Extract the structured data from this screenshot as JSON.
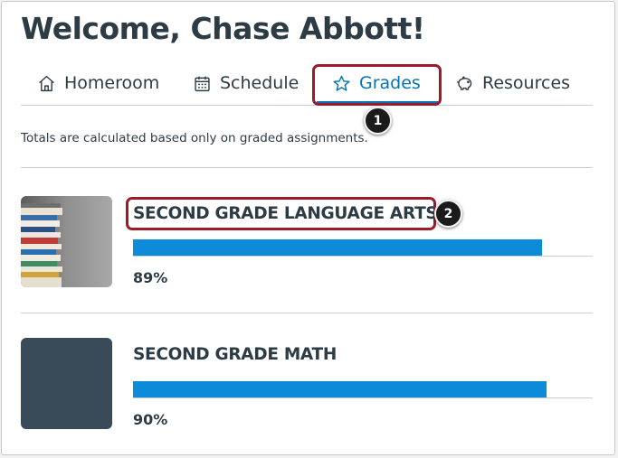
{
  "header": {
    "welcome": "Welcome, Chase Abbott!"
  },
  "tabs": [
    {
      "label": "Homeroom",
      "icon": "home-icon",
      "selected": false
    },
    {
      "label": "Schedule",
      "icon": "calendar-icon",
      "selected": false
    },
    {
      "label": "Grades",
      "icon": "star-icon",
      "selected": true
    },
    {
      "label": "Resources",
      "icon": "piggy-bank-icon",
      "selected": false
    }
  ],
  "callouts": [
    "1",
    "2"
  ],
  "note": "Totals are calculated based only on graded assignments.",
  "courses": [
    {
      "title": "SECOND GRADE LANGUAGE ARTS",
      "grade": "89%",
      "progress": 0.89,
      "image": "stacked-books"
    },
    {
      "title": "SECOND GRADE MATH",
      "grade": "90%",
      "progress": 0.9,
      "color": "#394b58"
    }
  ],
  "colors": {
    "accent": "#0374b5",
    "bar": "#0b8bd8",
    "text": "#2d3b45",
    "highlight": "#9b1c29"
  }
}
